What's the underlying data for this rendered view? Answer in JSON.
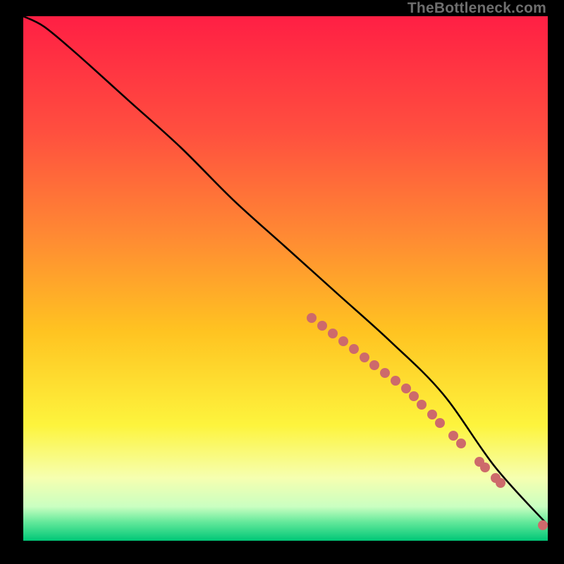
{
  "watermark": "TheBottleneck.com",
  "chart_data": {
    "type": "line",
    "title": "",
    "xlabel": "",
    "ylabel": "",
    "xlim": [
      0,
      100
    ],
    "ylim": [
      0,
      100
    ],
    "grid": false,
    "series": [
      {
        "name": "curve",
        "color": "#000000",
        "x": [
          0,
          4,
          10,
          20,
          30,
          40,
          50,
          60,
          70,
          80,
          90,
          100
        ],
        "y": [
          100,
          98,
          93,
          84,
          75,
          65,
          56,
          47,
          38,
          28,
          14,
          3
        ]
      },
      {
        "name": "markers",
        "color": "#cd6a6b",
        "x": [
          55,
          57,
          59,
          61,
          63,
          65,
          67,
          69,
          71,
          73,
          74.5,
          76,
          78,
          79.5,
          82,
          83.5,
          87,
          88,
          90,
          91,
          99
        ],
        "y": [
          42.5,
          41,
          39.5,
          38,
          36.5,
          35,
          33.5,
          32,
          30.5,
          29,
          27.5,
          26,
          24,
          22.5,
          20,
          18.5,
          15,
          14,
          12,
          11,
          3
        ]
      }
    ],
    "gradient_stops": [
      {
        "offset": 0.0,
        "color": "#ff1f44"
      },
      {
        "offset": 0.22,
        "color": "#ff4f3f"
      },
      {
        "offset": 0.42,
        "color": "#ff8a33"
      },
      {
        "offset": 0.6,
        "color": "#ffc321"
      },
      {
        "offset": 0.78,
        "color": "#fdf43d"
      },
      {
        "offset": 0.88,
        "color": "#f6ffb0"
      },
      {
        "offset": 0.935,
        "color": "#caffc1"
      },
      {
        "offset": 0.965,
        "color": "#62e89a"
      },
      {
        "offset": 1.0,
        "color": "#00c777"
      }
    ]
  }
}
